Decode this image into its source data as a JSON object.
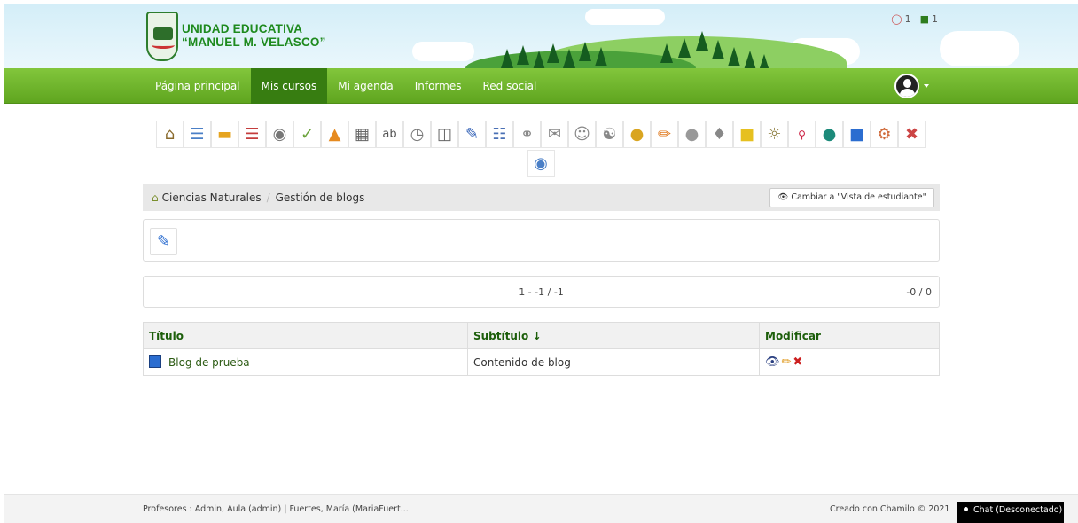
{
  "header": {
    "school_line1": "UNIDAD EDUCATIVA",
    "school_line2": "“MANUEL M. VELASCO”",
    "users_count": "1",
    "messages_count": "1"
  },
  "nav": {
    "items": [
      {
        "label": "Página principal"
      },
      {
        "label": "Mis cursos"
      },
      {
        "label": "Mi agenda"
      },
      {
        "label": "Informes"
      },
      {
        "label": "Red social"
      }
    ]
  },
  "tools": {
    "icons": [
      "home-icon",
      "course-description-icon",
      "documents-icon",
      "learning-path-icon",
      "links-icon",
      "tests-icon",
      "announcements-icon",
      "gradebook-icon",
      "glossary-icon",
      "attendance-icon",
      "course-progress-icon",
      "wiki-icon",
      "calendar-icon",
      "groups-icon",
      "dropbox-icon",
      "users-icon",
      "group-users-icon",
      "chat-icon",
      "assignments-icon",
      "notebook-icon",
      "survey-icon",
      "notes-icon",
      "surveys-icon",
      "search-icon",
      "forum-icon",
      "blogs-icon",
      "course-settings-icon",
      "maintenance-icon",
      "video-conference-icon"
    ]
  },
  "breadcrumb": {
    "course": "Ciencias Naturales",
    "current": "Gestión de blogs",
    "student_view_label": "Cambiar a \"Vista de estudiante\""
  },
  "pager": {
    "range": "1 - -1 / -1",
    "right": "-0 / 0"
  },
  "table": {
    "headers": {
      "title": "Título",
      "subtitle": "Subtítulo ↓",
      "modify": "Modificar"
    },
    "rows": [
      {
        "title": "Blog de prueba",
        "subtitle": "Contenido de blog"
      }
    ]
  },
  "footer": {
    "teachers": "Profesores : Admin, Aula (admin) | Fuertes, María (MariaFuert...",
    "credit": "Creado con Chamilo © 2021",
    "chat": "Chat (Desconectado)"
  }
}
